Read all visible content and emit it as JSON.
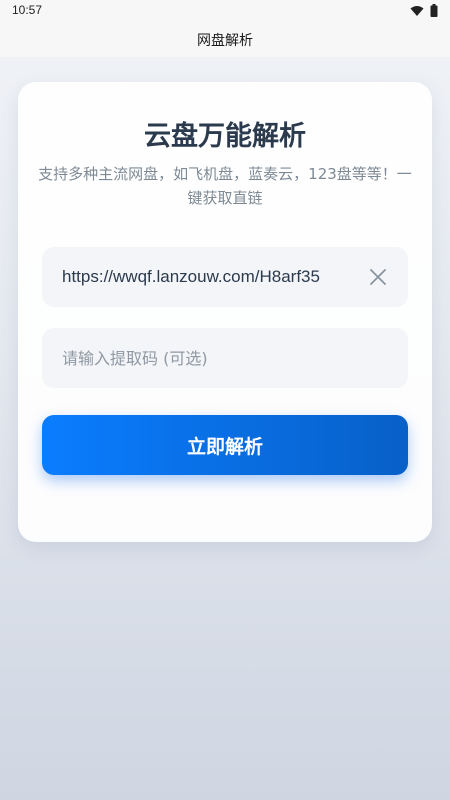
{
  "status_bar": {
    "time": "10:57",
    "icons": [
      "wifi-icon",
      "battery-icon"
    ]
  },
  "app_bar": {
    "title": "网盘解析"
  },
  "card": {
    "title": "云盘万能解析",
    "subtitle": "支持多种主流网盘，如飞机盘，蓝奏云，123盘等等！一键获取直链",
    "url_field": {
      "value": "https://wwqf.lanzouw.com/H8arf35",
      "placeholder": ""
    },
    "code_field": {
      "value": "",
      "placeholder": "请输入提取码 (可选)"
    },
    "submit_label": "立即解析"
  },
  "colors": {
    "accent": "#0a7dff",
    "title": "#2b3a4d",
    "subtitle": "#7d8a95"
  }
}
